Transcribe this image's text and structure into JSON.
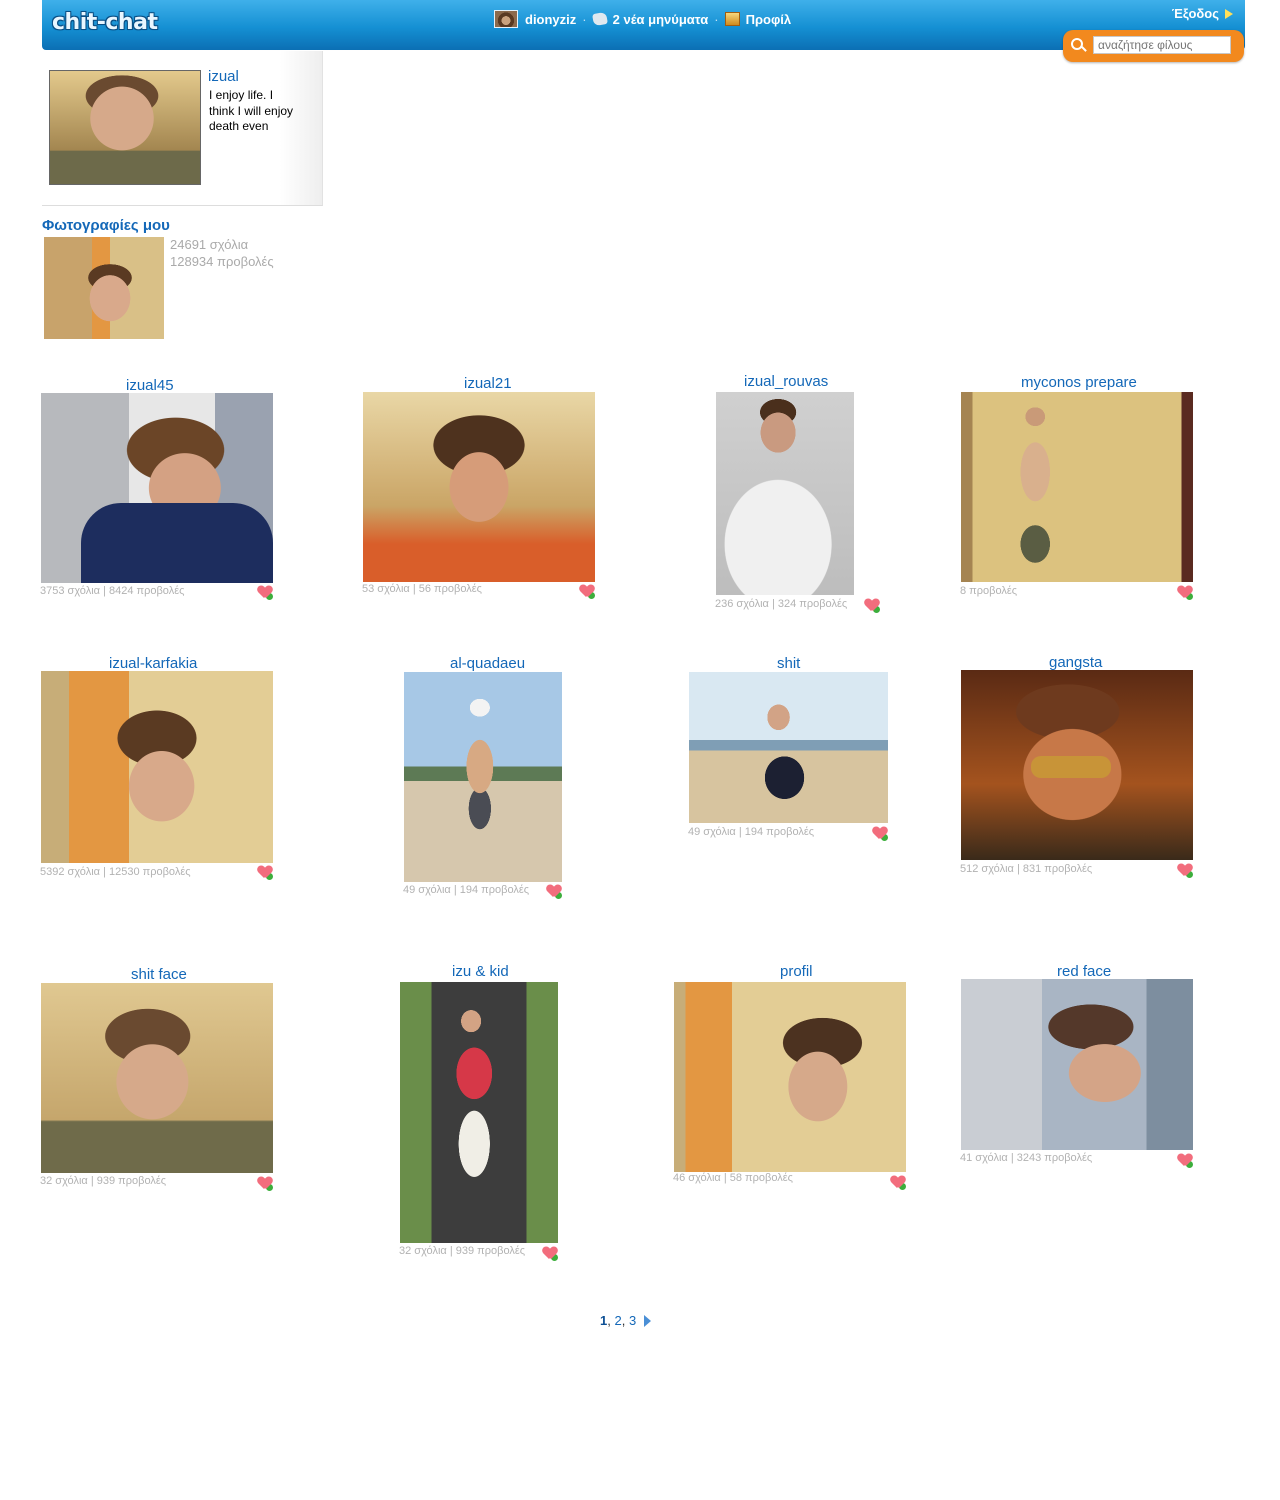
{
  "header": {
    "logo": "chit-chat",
    "user": "dionyziz",
    "messages": "2 νέα μηνύματα",
    "profile": "Προφίλ",
    "logout": "Έξοδος",
    "search_placeholder": "αναζήτησε φίλους"
  },
  "profile": {
    "name": "izual",
    "bio": "I enjoy life. I think I will enjoy death even more."
  },
  "my_photos": {
    "title": "Φωτογραφίες μου",
    "comments": "24691 σχόλια",
    "views": "128934 προβολές"
  },
  "albums": [
    {
      "title": "izual45",
      "stats": "3753 σχόλια | 8424 προβολές"
    },
    {
      "title": "izual21",
      "stats": "53 σχόλια | 56 προβολές"
    },
    {
      "title": "izual_rouvas",
      "stats": "236 σχόλια | 324 προβολές"
    },
    {
      "title": "myconos prepare",
      "stats": "8 προβολές"
    },
    {
      "title": "izual-karfakia",
      "stats": "5392 σχόλια | 12530 προβολές"
    },
    {
      "title": "al-quadaeu",
      "stats": "49 σχόλια | 194 προβολές"
    },
    {
      "title": "shit",
      "stats": "49 σχόλια | 194 προβολές"
    },
    {
      "title": "gangsta",
      "stats": "512 σχόλια | 831 προβολές"
    },
    {
      "title": "shit face",
      "stats": "32 σχόλια | 939 προβολές"
    },
    {
      "title": "izu & kid",
      "stats": "32 σχόλια | 939 προβολές"
    },
    {
      "title": "profil",
      "stats": "46 σχόλια | 58 προβολές"
    },
    {
      "title": "red face",
      "stats": "41 σχόλια | 3243 προβολές"
    }
  ],
  "pagination": {
    "pages": [
      "1",
      "2",
      "3"
    ],
    "current": "1"
  }
}
